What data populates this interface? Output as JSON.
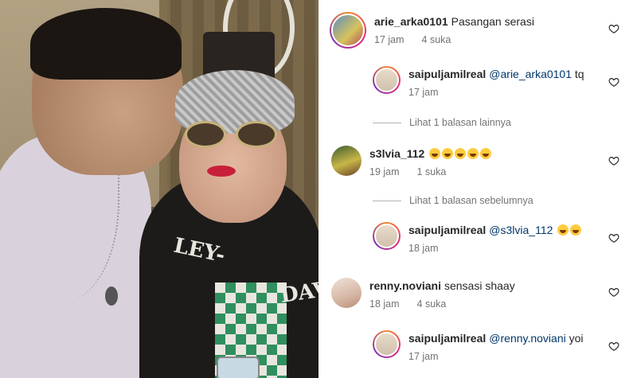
{
  "comments": [
    {
      "username": "arie_arka0101",
      "text": "Pasangan serasi",
      "mention": "",
      "time": "17 jam",
      "likes": "4 suka",
      "emojis": 0,
      "avatar_color": "#6fa0c8"
    },
    {
      "username": "saipuljamilreal",
      "text": " tq",
      "mention": "@arie_arka0101",
      "time": "17 jam",
      "likes": "",
      "emojis": 0,
      "avatar_color": "#d9c7b0"
    },
    {
      "username": "s3lvia_112",
      "text": "",
      "mention": "",
      "time": "19 jam",
      "likes": "1 suka",
      "emojis": 5,
      "avatar_color": "#a6b23c"
    },
    {
      "username": "saipuljamilreal",
      "text": "",
      "mention": "@s3lvia_112",
      "time": "18 jam",
      "likes": "",
      "emojis": 2,
      "avatar_color": "#d9c7b0"
    },
    {
      "username": "renny.noviani",
      "text": "sensasi shaay",
      "mention": "",
      "time": "18 jam",
      "likes": "4 suka",
      "emojis": 0,
      "avatar_color": "#e7cfc2"
    },
    {
      "username": "saipuljamilreal",
      "text": " yoi",
      "mention": "@renny.noviani",
      "time": "17 jam",
      "likes": "",
      "emojis": 0,
      "avatar_color": "#d9c7b0"
    }
  ],
  "view_more_replies": [
    "Lihat 1 balasan lainnya",
    "Lihat 1 balasan sebelumnya"
  ],
  "photo": {
    "jacket_text_left": "LEY-",
    "jacket_text_right": "DAVI"
  },
  "colors": {
    "username": "#262626",
    "mention": "#00376b",
    "meta": "#737373",
    "heart": "#262626"
  },
  "icons": {
    "like": "heart-outline-icon",
    "emoji": "grinning-emoji"
  }
}
